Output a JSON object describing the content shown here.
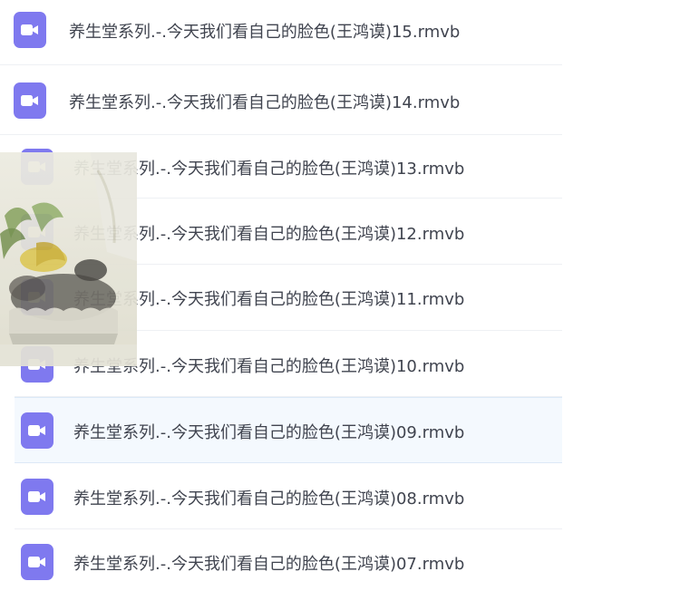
{
  "files": [
    {
      "name": "养生堂系列.-.今天我们看自己的脸色(王鸿谟)15.rmvb",
      "icon": "video-file-icon"
    },
    {
      "name": "养生堂系列.-.今天我们看自己的脸色(王鸿谟)14.rmvb",
      "icon": "video-file-icon"
    },
    {
      "name": "养生堂系列.-.今天我们看自己的脸色(王鸿谟)13.rmvb",
      "icon": "video-file-icon"
    },
    {
      "name": "养生堂系列.-.今天我们看自己的脸色(王鸿谟)12.rmvb",
      "icon": "video-file-icon"
    },
    {
      "name": "养生堂系列.-.今天我们看自己的脸色(王鸿谟)11.rmvb",
      "icon": "video-file-icon"
    },
    {
      "name": "养生堂系列.-.今天我们看自己的脸色(王鸿谟)10.rmvb",
      "icon": "video-file-icon"
    },
    {
      "name": "养生堂系列.-.今天我们看自己的脸色(王鸿谟)09.rmvb",
      "icon": "video-file-icon",
      "selected": true
    },
    {
      "name": "养生堂系列.-.今天我们看自己的脸色(王鸿谟)08.rmvb",
      "icon": "video-file-icon"
    },
    {
      "name": "养生堂系列.-.今天我们看自己的脸色(王鸿谟)07.rmvb",
      "icon": "video-file-icon"
    }
  ],
  "colors": {
    "icon_bg": "#7f79ef",
    "text": "#40444f",
    "row_divider": "#eef0f4",
    "selected_bg": "#f4f9fe"
  }
}
